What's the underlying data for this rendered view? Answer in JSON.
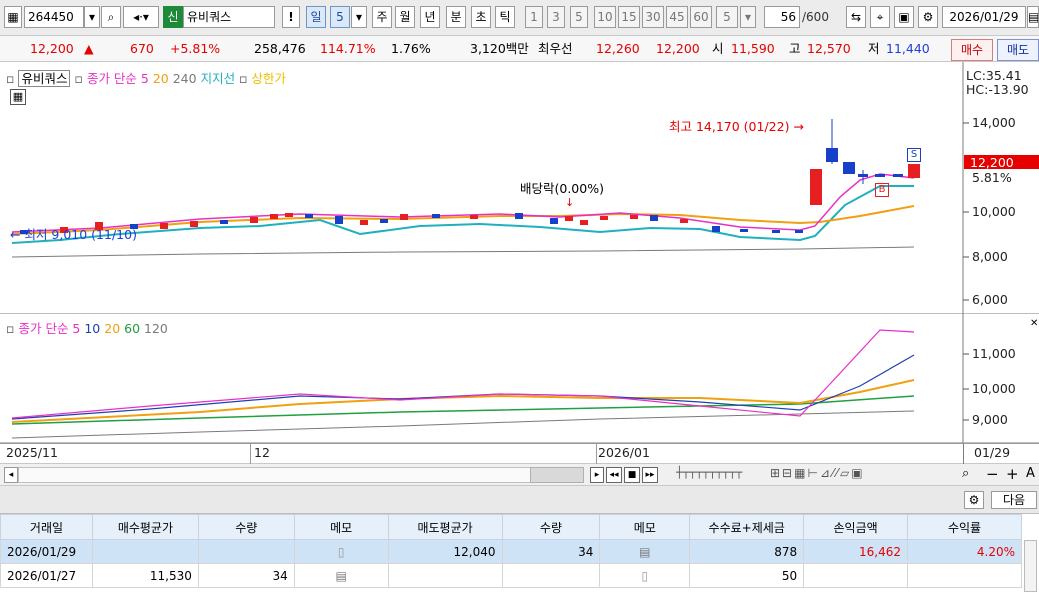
{
  "toolbar": {
    "code": "264450",
    "badge": "신",
    "name": "유비쿼스",
    "warn": "!",
    "periods": [
      "일",
      "5",
      "주",
      "월",
      "년",
      "분",
      "초",
      "틱"
    ],
    "intervals": [
      "1",
      "3",
      "5",
      "10",
      "15",
      "30",
      "45",
      "60",
      "5"
    ],
    "count": "56",
    "count_max": "/600",
    "date": "2026/01/29"
  },
  "pricebar": {
    "price": "12,200",
    "change": "670",
    "change_pct": "+5.81%",
    "volume": "258,476",
    "vol_ratio": "114.71%",
    "turnover": "1.76%",
    "amount": "3,120백만",
    "best_label": "최우선",
    "ask": "12,260",
    "bid": "12,200",
    "open_label": "시",
    "open": "11,590",
    "high_label": "고",
    "high": "12,570",
    "low_label": "저",
    "low": "11,440",
    "buy_label": "매수",
    "sell_label": "매도"
  },
  "price_pane": {
    "legend_name": "유비쿼스",
    "legend_items": [
      "종가 단순 5",
      "20",
      "240",
      "지지선",
      "상한가"
    ],
    "lc": "LC:35.41",
    "hc": "HC:-13.90",
    "ticks": [
      "14,000",
      "12,200",
      "5.81%",
      "10,000",
      "8,000",
      "6,000"
    ],
    "annot_high": "최고 14,170 (01/22) →",
    "annot_low": "← 최저 9,010 (11/10)",
    "annot_div": "배당락(0.00%)",
    "marker_s": "S",
    "marker_b": "B"
  },
  "ma_pane": {
    "legend_items": [
      "종가 단순 5",
      "10",
      "20",
      "60",
      "120"
    ],
    "ticks": [
      "11,000",
      "10,000",
      "9,000"
    ]
  },
  "xaxis": {
    "labels": [
      "2025/11",
      "12",
      "2026/01",
      "01/29"
    ]
  },
  "bottom": {
    "next_label": "다음"
  },
  "table": {
    "headers": [
      "거래일",
      "매수평균가",
      "수량",
      "메모",
      "매도평균가",
      "수량",
      "메모",
      "수수료+제세금",
      "손익금액",
      "수익률"
    ],
    "rows": [
      [
        "2026/01/29",
        "",
        "",
        "",
        "12,040",
        "34",
        "",
        "878",
        "16,462",
        "4.20%"
      ],
      [
        "2026/01/27",
        "11,530",
        "34",
        "",
        "",
        "",
        "",
        "50",
        "",
        ""
      ]
    ]
  },
  "colors": {
    "up": "#e62020",
    "down": "#1640c8",
    "ma5": "#e830c8",
    "ma20": "#f0a010",
    "ma240": "#7a7a7a",
    "support": "#1fb0c0",
    "ma10": "#2040b0",
    "ma60": "#20a040"
  },
  "chart_data": {
    "type": "candlestick",
    "series": [
      {
        "name": "종가 단순 5",
        "values": []
      },
      {
        "name": "20",
        "values": []
      },
      {
        "name": "240",
        "values": []
      }
    ]
  }
}
